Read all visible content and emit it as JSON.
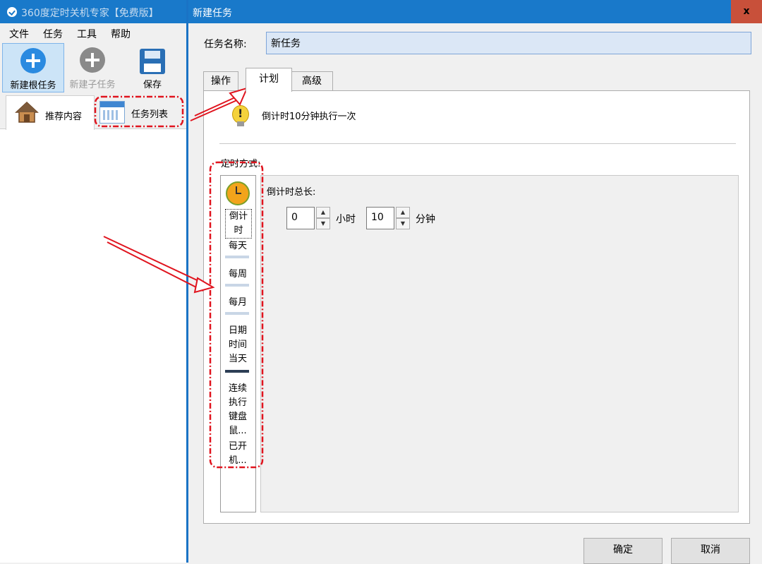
{
  "app": {
    "title": "360度定时关机专家【免费版】",
    "menu": [
      "文件",
      "任务",
      "工具",
      "帮助"
    ],
    "toolbar": {
      "new_root_task": "新建根任务",
      "new_child_task": "新建子任务",
      "save": "保存"
    },
    "tabs": {
      "recommend": "推荐内容",
      "task_list": "任务列表"
    },
    "colors": {
      "titlebar": "#1979ca",
      "accent_blue": "#2a8ae0",
      "disabled_gray": "#8a8a8a"
    }
  },
  "dialog": {
    "title": "新建任务",
    "close": "x",
    "task_name_label": "任务名称:",
    "task_name_value": "新任务",
    "tabs": [
      "操作",
      "计划",
      "高级"
    ],
    "summary": "倒计时10分钟执行一次",
    "mode_label": "定时方式:",
    "modes": [
      "倒计\n时",
      "每天",
      "每周",
      "每月",
      "日期\n时间",
      "当天",
      "连续\n执行",
      "键盘\n鼠...",
      "已开\n机..."
    ],
    "countdown": {
      "label": "倒计时总长:",
      "hours_value": "0",
      "hours_unit": "小时",
      "minutes_value": "10",
      "minutes_unit": "分钟"
    },
    "ok": "确定",
    "cancel": "取消"
  },
  "icons": [
    "plus-circle-icon",
    "floppy-disk-icon",
    "house-icon",
    "calendar-icon",
    "lightbulb-warning-icon",
    "alarm-clock-icon",
    "spin-up-icon",
    "spin-down-icon",
    "close-icon"
  ]
}
